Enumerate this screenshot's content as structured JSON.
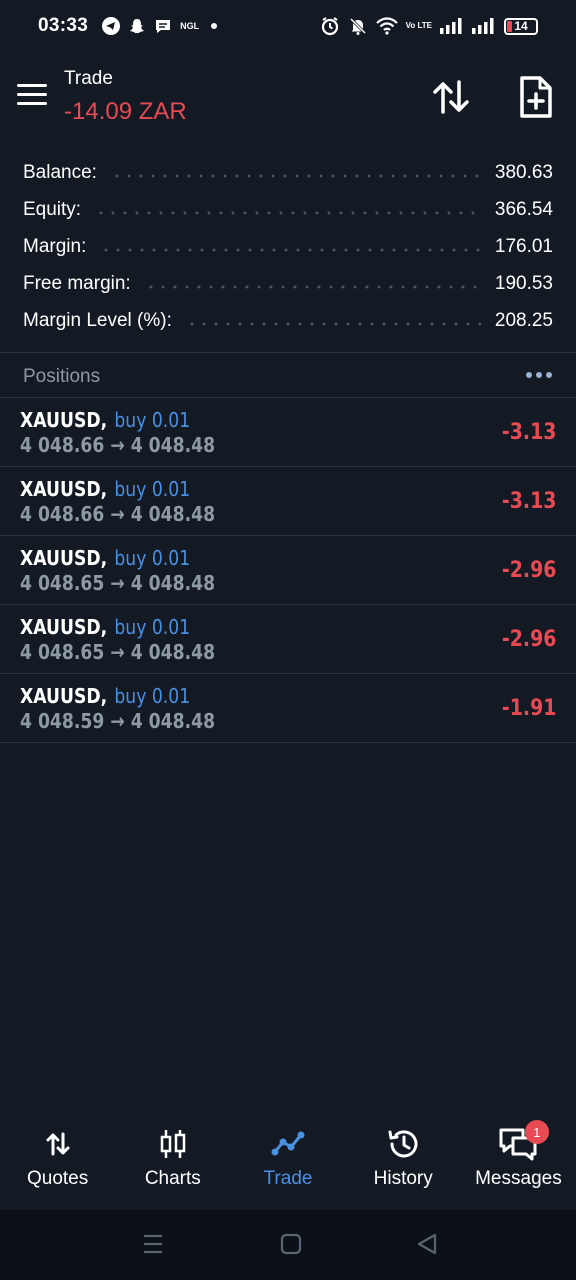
{
  "status_bar": {
    "time": "03:33",
    "ngl_label": "NGL",
    "network_label": "Vo LTE",
    "battery_level": "14"
  },
  "header": {
    "title": "Trade",
    "subtitle": "-14.09 ZAR"
  },
  "summary": [
    {
      "label": "Balance:",
      "value": "380.63"
    },
    {
      "label": "Equity:",
      "value": "366.54"
    },
    {
      "label": "Margin:",
      "value": "176.01"
    },
    {
      "label": "Free margin:",
      "value": "190.53"
    },
    {
      "label": "Margin Level (%):",
      "value": "208.25"
    }
  ],
  "positions": {
    "title": "Positions",
    "items": [
      {
        "symbol": "XAUUSD,",
        "type": "buy 0.01",
        "prices": "4 048.66 → 4 048.48",
        "profit": "-3.13"
      },
      {
        "symbol": "XAUUSD,",
        "type": "buy 0.01",
        "prices": "4 048.66 → 4 048.48",
        "profit": "-3.13"
      },
      {
        "symbol": "XAUUSD,",
        "type": "buy 0.01",
        "prices": "4 048.65 → 4 048.48",
        "profit": "-2.96"
      },
      {
        "symbol": "XAUUSD,",
        "type": "buy 0.01",
        "prices": "4 048.65 → 4 048.48",
        "profit": "-2.96"
      },
      {
        "symbol": "XAUUSD,",
        "type": "buy 0.01",
        "prices": "4 048.59 → 4 048.48",
        "profit": "-1.91"
      }
    ]
  },
  "bottom_nav": {
    "items": [
      {
        "label": "Quotes",
        "icon": "quotes-icon"
      },
      {
        "label": "Charts",
        "icon": "candlestick-icon"
      },
      {
        "label": "Trade",
        "icon": "trade-icon",
        "active": true
      },
      {
        "label": "History",
        "icon": "history-icon"
      },
      {
        "label": "Messages",
        "icon": "messages-icon",
        "badge": "1"
      }
    ]
  },
  "colors": {
    "background": "#131a24",
    "loss": "#e84a54",
    "accent": "#4a90e2",
    "muted": "#8e99a6"
  }
}
